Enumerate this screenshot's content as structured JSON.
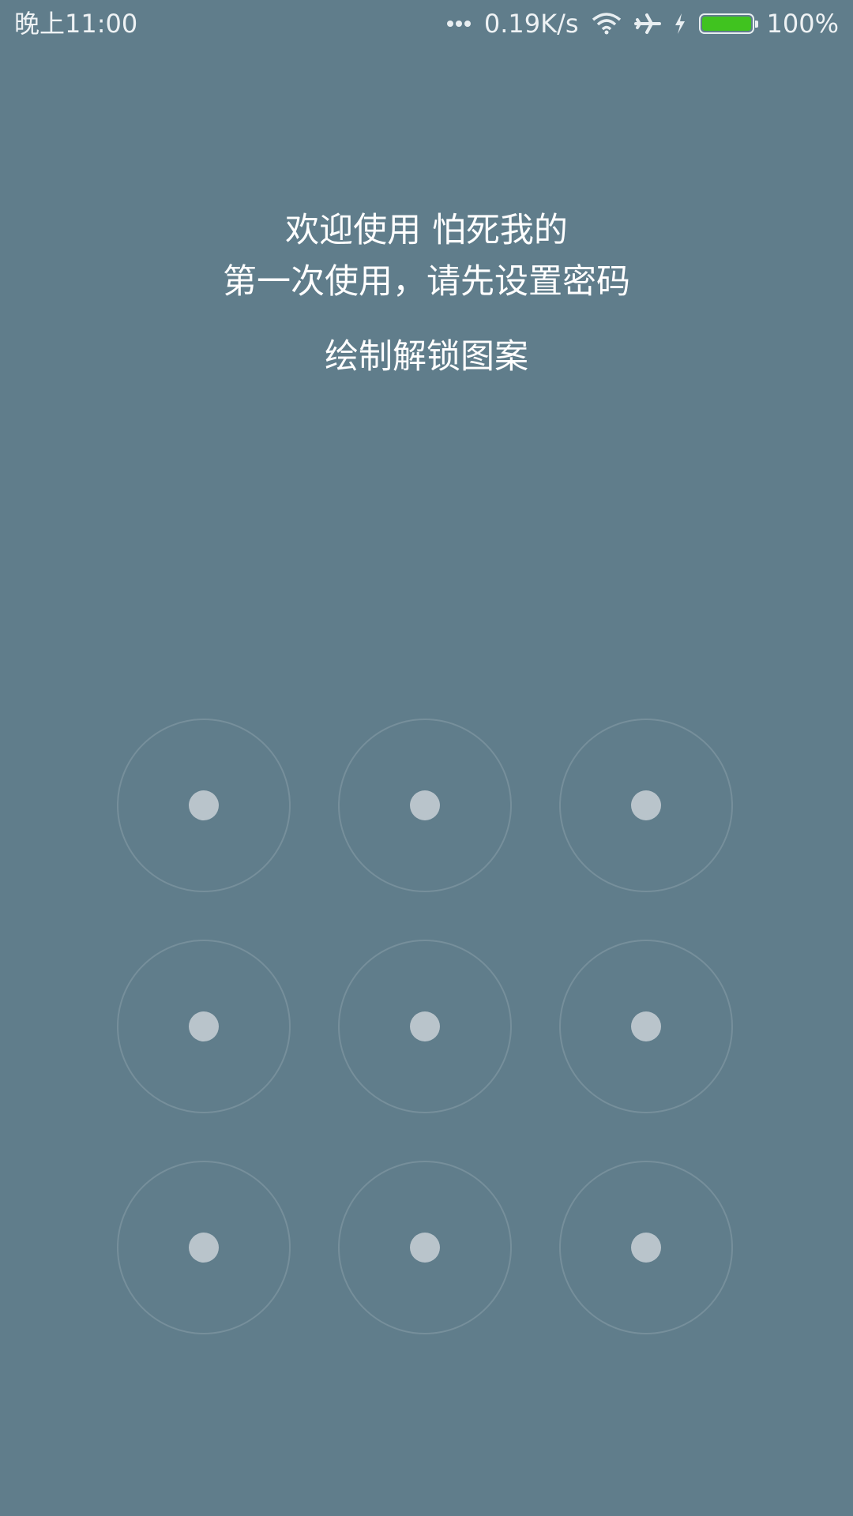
{
  "status_bar": {
    "time": "晚上11:00",
    "network_speed": "0.19K/s",
    "battery_percent": "100%",
    "battery_level": 1.0,
    "icons": [
      "dots-icon",
      "wifi-icon",
      "airplane-icon",
      "charge-icon",
      "battery-icon"
    ],
    "battery_color": "#40c31f"
  },
  "welcome": {
    "title": "欢迎使用 怕死我的",
    "subtitle": "第一次使用，请先设置密码",
    "instruction": "绘制解锁图案"
  },
  "pattern": {
    "rows": 3,
    "cols": 3,
    "background": "#607d8b",
    "dot_color": "#b9c4cb"
  }
}
